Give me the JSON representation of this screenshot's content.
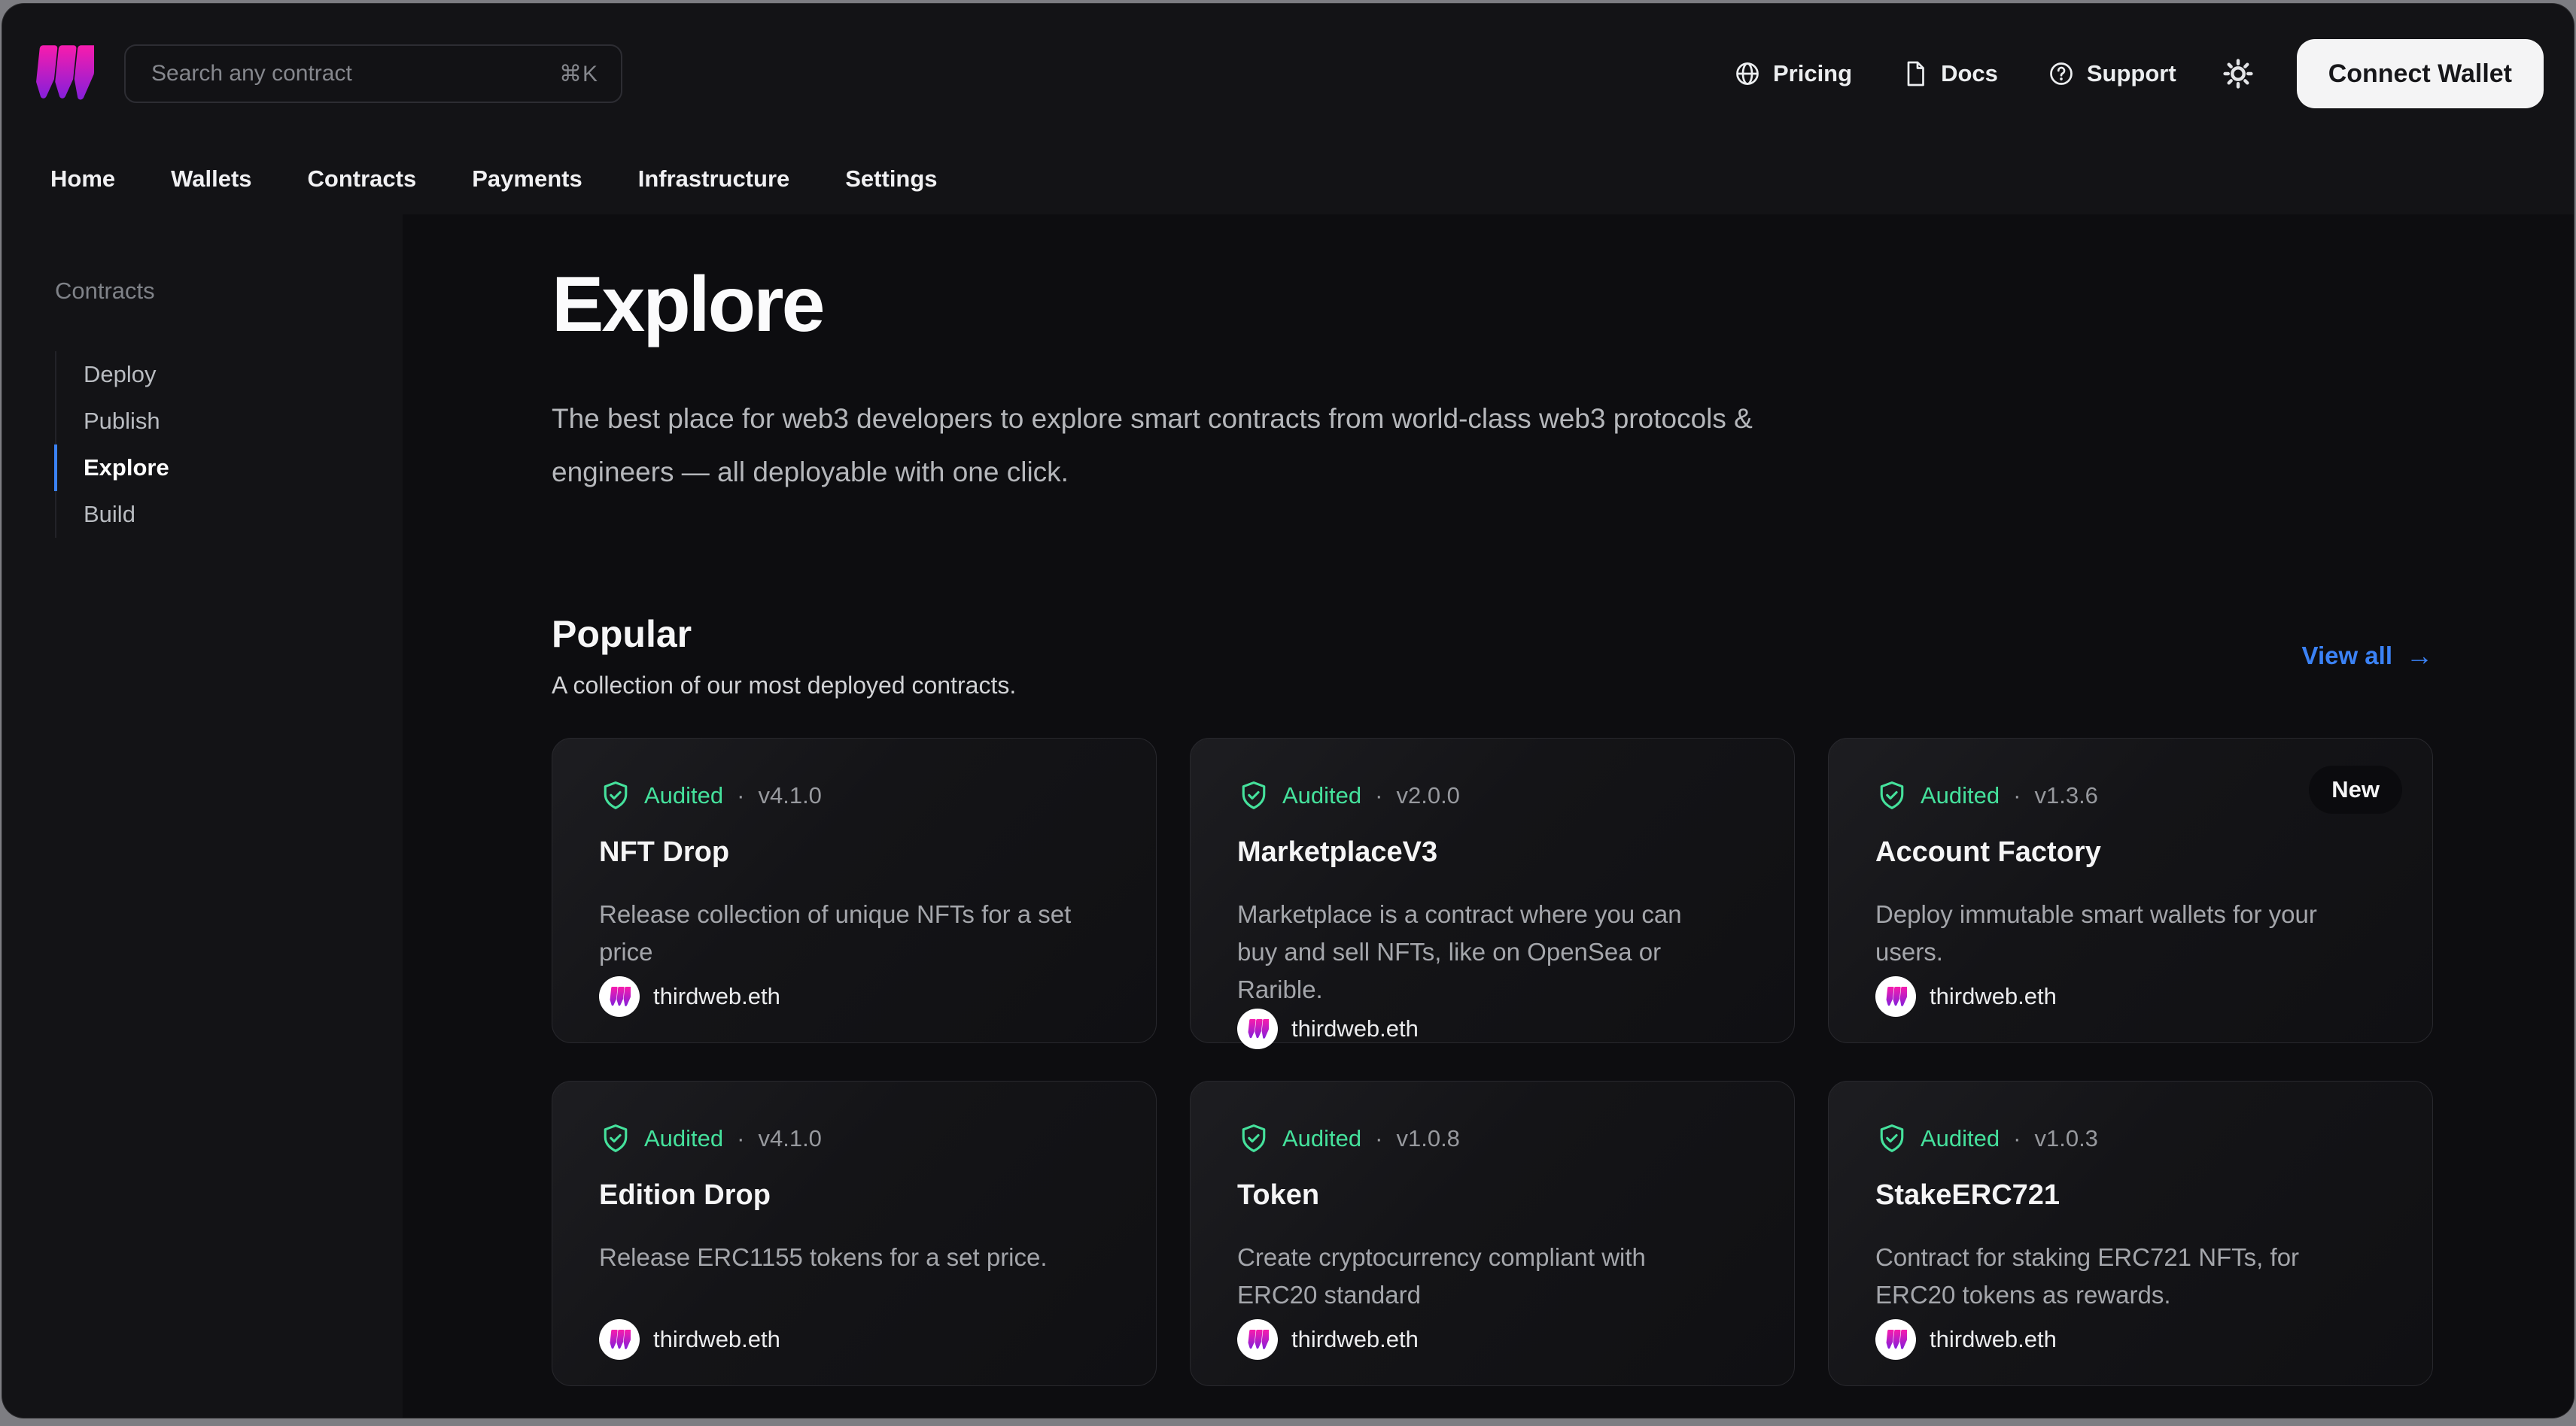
{
  "header": {
    "search": {
      "placeholder": "Search any contract",
      "shortcut": "⌘K"
    },
    "links": [
      {
        "label": "Pricing",
        "icon": "globe-icon"
      },
      {
        "label": "Docs",
        "icon": "document-icon"
      },
      {
        "label": "Support",
        "icon": "help-circle-icon"
      }
    ],
    "theme_toggle_icon": "sun-icon",
    "connect_wallet_label": "Connect Wallet"
  },
  "nav": {
    "tabs": [
      "Home",
      "Wallets",
      "Contracts",
      "Payments",
      "Infrastructure",
      "Settings"
    ]
  },
  "sidebar": {
    "title": "Contracts",
    "items": [
      {
        "label": "Deploy",
        "active": false
      },
      {
        "label": "Publish",
        "active": false
      },
      {
        "label": "Explore",
        "active": true
      },
      {
        "label": "Build",
        "active": false
      }
    ]
  },
  "main": {
    "title": "Explore",
    "subtitle": "The best place for web3 developers to explore smart contracts from world-class web3 protocols & engineers — all deployable with one click.",
    "separator": "·",
    "popular": {
      "heading": "Popular",
      "description": "A collection of our most deployed contracts.",
      "view_all_label": "View all",
      "view_all_arrow": "→"
    },
    "cards": [
      {
        "audited_label": "Audited",
        "version": "v4.1.0",
        "title": "NFT Drop",
        "description": "Release collection of unique NFTs for a set price",
        "publisher": "thirdweb.eth",
        "new_label": ""
      },
      {
        "audited_label": "Audited",
        "version": "v2.0.0",
        "title": "MarketplaceV3",
        "description": "Marketplace is a contract where you can buy and sell NFTs, like on OpenSea or Rarible.",
        "publisher": "thirdweb.eth",
        "new_label": ""
      },
      {
        "audited_label": "Audited",
        "version": "v1.3.6",
        "title": "Account Factory",
        "description": "Deploy immutable smart wallets for your users.",
        "publisher": "thirdweb.eth",
        "new_label": "New"
      },
      {
        "audited_label": "Audited",
        "version": "v4.1.0",
        "title": "Edition Drop",
        "description": "Release ERC1155 tokens for a set price.",
        "publisher": "thirdweb.eth",
        "new_label": ""
      },
      {
        "audited_label": "Audited",
        "version": "v1.0.8",
        "title": "Token",
        "description": "Create cryptocurrency compliant with ERC20 standard",
        "publisher": "thirdweb.eth",
        "new_label": ""
      },
      {
        "audited_label": "Audited",
        "version": "v1.0.3",
        "title": "StakeERC721",
        "description": "Contract for staking ERC721 NFTs, for ERC20 tokens as rewards.",
        "publisher": "thirdweb.eth",
        "new_label": ""
      }
    ]
  },
  "colors": {
    "accent_blue": "#3b82f6",
    "audited_green": "#45e19c",
    "brand_pink": "#f21caf",
    "brand_purple": "#8b1fd8",
    "window_bg": "#131316",
    "main_bg": "#0d0d10",
    "connect_button_bg": "#f4f4f5"
  }
}
